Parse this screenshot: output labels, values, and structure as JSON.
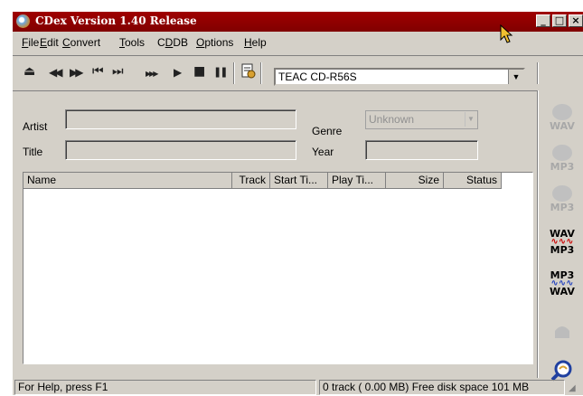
{
  "window": {
    "title": "CDex Version 1.40 Release"
  },
  "titlebar_buttons": {
    "minimize": "_",
    "maximize": "□",
    "close": "×"
  },
  "menu": [
    {
      "label": "File",
      "u": "F",
      "rest": "ile"
    },
    {
      "label": "Edit",
      "u": "E",
      "rest": "dit"
    },
    {
      "label": "Convert",
      "u": "C",
      "rest": "onvert"
    },
    {
      "label": "Tools",
      "u": "T",
      "rest": "ools"
    },
    {
      "label": "CDDB",
      "pre": "C",
      "u": "D",
      "rest": "DB"
    },
    {
      "label": "Options",
      "u": "O",
      "rest": "ptions"
    },
    {
      "label": "Help",
      "u": "H",
      "rest": "elp"
    }
  ],
  "toolbar": {
    "icons": {
      "eject": "⏏",
      "rewind": "◀◀",
      "fast_forward": "▶▶",
      "prev": "⏮",
      "next": "⏭",
      "skip": "▶▶▶",
      "play": "▶",
      "stop": "■",
      "pause": "❚❚"
    },
    "drive": "TEAC  CD-R56S"
  },
  "form": {
    "artist_label": "Artist",
    "title_label": "Title",
    "genre_label": "Genre",
    "year_label": "Year",
    "genre_value": "Unknown",
    "artist_value": "",
    "title_value": "",
    "year_value": ""
  },
  "track_list": {
    "columns": [
      "Name",
      "Track",
      "Start Ti...",
      "Play Ti...",
      "Size",
      "Status"
    ],
    "rows": []
  },
  "sidebar_buttons": [
    {
      "label": "WAV",
      "enabled": false
    },
    {
      "label": "MP3",
      "enabled": false
    },
    {
      "label": "MP3",
      "enabled": false
    },
    {
      "top": "WAV",
      "bottom": "MP3",
      "enabled": true
    },
    {
      "top": "MP3",
      "bottom": "WAV",
      "enabled": true
    },
    {
      "label": "",
      "enabled": false
    },
    {
      "label": "",
      "enabled": true
    }
  ],
  "status": {
    "help": "For Help, press F1",
    "info": "0 track ( 0.00 MB) Free disk space  101 MB"
  },
  "colors": {
    "title_bg": "#800000",
    "face": "#d4d0c8",
    "wav": "#000000",
    "mp3_wave": "#cc0000"
  }
}
